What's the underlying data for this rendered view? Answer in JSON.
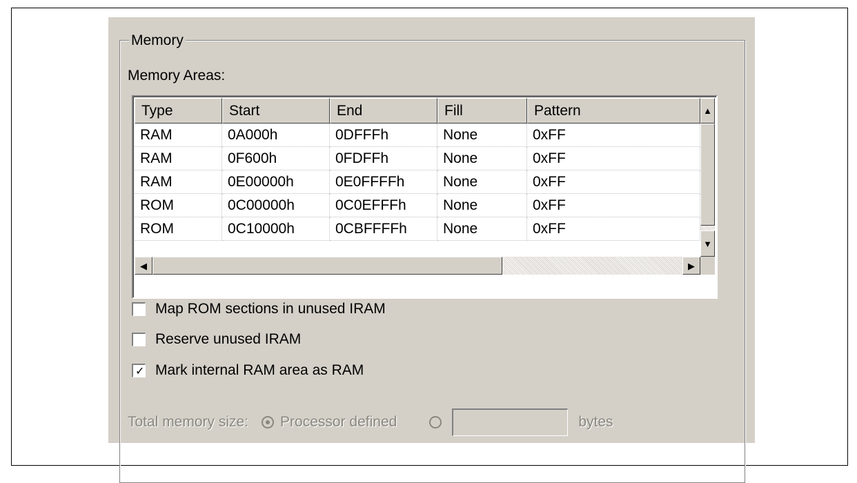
{
  "group": {
    "title": "Memory"
  },
  "memory_areas_label": "Memory Areas:",
  "table": {
    "columns": [
      "Type",
      "Start",
      "End",
      "Fill",
      "Pattern"
    ],
    "rows": [
      [
        "RAM",
        "0A000h",
        "0DFFFh",
        "None",
        "0xFF"
      ],
      [
        "RAM",
        "0F600h",
        "0FDFFh",
        "None",
        "0xFF"
      ],
      [
        "RAM",
        "0E00000h",
        "0E0FFFFh",
        "None",
        "0xFF"
      ],
      [
        "ROM",
        "0C00000h",
        "0C0EFFFh",
        "None",
        "0xFF"
      ],
      [
        "ROM",
        "0C10000h",
        "0CBFFFFh",
        "None",
        "0xFF"
      ]
    ]
  },
  "checkboxes": [
    {
      "label": "Map ROM sections in unused IRAM",
      "checked": false
    },
    {
      "label": "Reserve unused IRAM",
      "checked": false
    },
    {
      "label": "Mark internal RAM area as RAM",
      "checked": true
    }
  ],
  "total_memory": {
    "label": "Total memory size:",
    "option_processor": "Processor defined",
    "bytes_value": "",
    "bytes_label": "bytes",
    "selected": "processor_defined",
    "enabled": false
  },
  "icons": {
    "scroll_up": "arrow-up-icon",
    "scroll_down": "arrow-down-icon",
    "scroll_left": "arrow-left-icon",
    "scroll_right": "arrow-right-icon",
    "checkmark": "checkmark-icon"
  }
}
